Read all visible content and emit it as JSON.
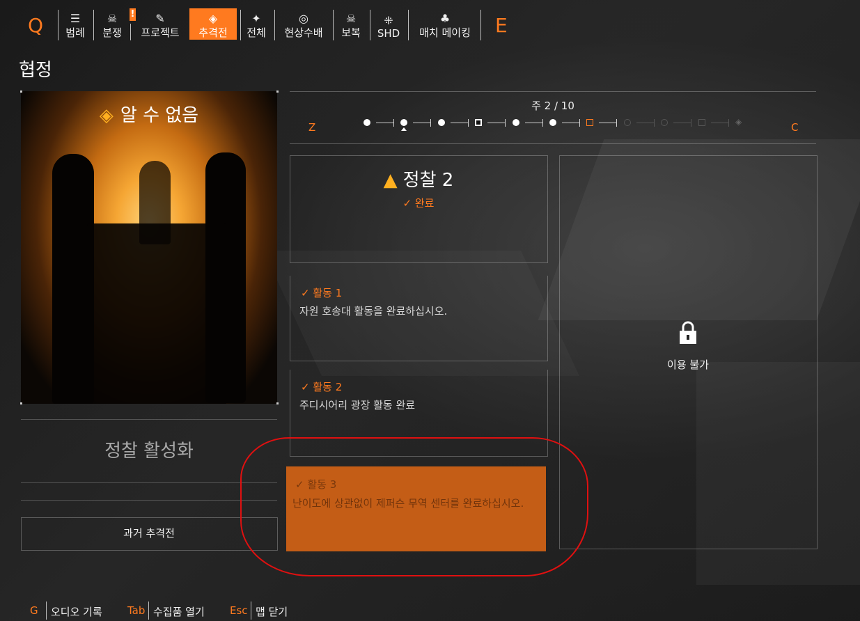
{
  "nav": {
    "left_key": "Q",
    "right_key": "E",
    "items": [
      {
        "label": "범례",
        "icon": "list-icon"
      },
      {
        "label": "분쟁",
        "icon": "skull-icon"
      },
      {
        "label": "프로젝트",
        "icon": "clipboard-icon"
      },
      {
        "label": "추격전",
        "icon": "manhunt-icon"
      },
      {
        "label": "전체",
        "icon": "overview-icon"
      },
      {
        "label": "현상수배",
        "icon": "target-icon"
      },
      {
        "label": "보복",
        "icon": "crossbones-icon"
      },
      {
        "label": "SHD",
        "icon": "shd-icon"
      },
      {
        "label": "매치 메이킹",
        "icon": "group-icon"
      }
    ],
    "badge": "!",
    "active": "추격전"
  },
  "page": {
    "title": "협정"
  },
  "hero": {
    "title": "알 수 없음",
    "icon": "manhunt-diamond-icon"
  },
  "left_panel": {
    "activate_label": "정찰 활성화",
    "past_manhunts_label": "과거 추격전"
  },
  "timeline": {
    "week_label": "주 2 / 10",
    "prev_key": "Z",
    "next_key": "C"
  },
  "recon": {
    "title": "정찰 2",
    "status": "✓ 완료",
    "activities": [
      {
        "title": "✓ 활동 1",
        "desc": "자원 호송대 활동을 완료하십시오."
      },
      {
        "title": "✓ 활동 2",
        "desc": "주디시어리 광장 활동 완료"
      },
      {
        "title": "✓ 활동 3",
        "desc": "난이도에 상관없이 제퍼슨 무역 센터를 완료하십시오."
      }
    ]
  },
  "locked": {
    "text": "이용 불가",
    "icon": "unlock-icon"
  },
  "footer": [
    {
      "key": "G",
      "label": "오디오 기록"
    },
    {
      "key": "Tab",
      "label": "수집품 열기"
    },
    {
      "key": "Esc",
      "label": "맵 닫기"
    }
  ],
  "colors": {
    "accent": "#ff7a1f",
    "annotation": "#e01010"
  }
}
